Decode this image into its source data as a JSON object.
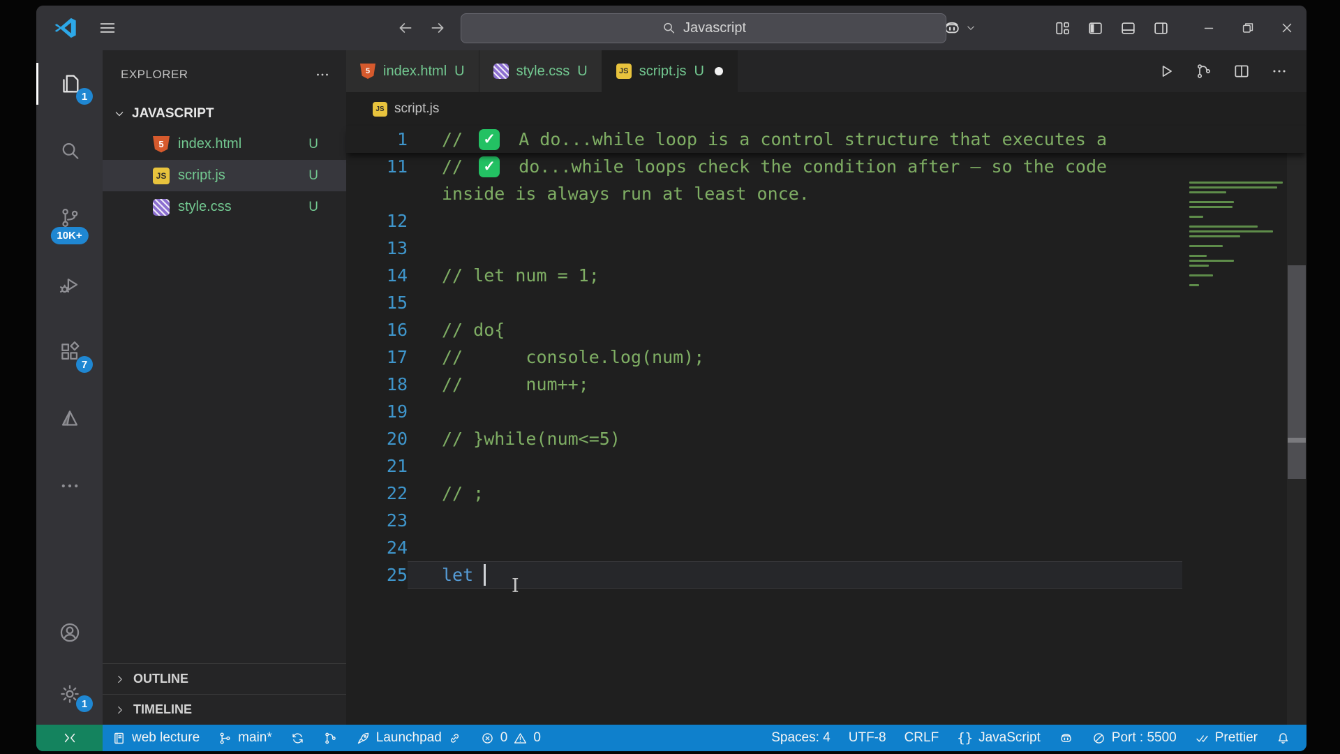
{
  "colors": {
    "status_bar": "#0f80cc",
    "remote": "#14835e",
    "badge": "#1f87d2",
    "comment_green": "#7fae64",
    "keyword_blue": "#569cd6",
    "untracked_green": "#73c991",
    "line_number_blue": "#3f96cc"
  },
  "titlebar": {
    "search_text": "Javascript"
  },
  "activity_bar": {
    "items": [
      {
        "id": "explorer",
        "icon": "files",
        "badge": "1",
        "active": true
      },
      {
        "id": "search",
        "icon": "search",
        "badge": ""
      },
      {
        "id": "source-control",
        "icon": "scm",
        "badge": "10K+",
        "pill": true
      },
      {
        "id": "run-and-debug",
        "icon": "debug",
        "badge": ""
      },
      {
        "id": "extensions",
        "icon": "ext",
        "badge": "7"
      },
      {
        "id": "prism-extension",
        "icon": "prism",
        "badge": ""
      },
      {
        "id": "additional-views",
        "icon": "more",
        "badge": ""
      }
    ],
    "bottom": [
      {
        "id": "accounts",
        "icon": "account",
        "badge": ""
      },
      {
        "id": "settings",
        "icon": "gear",
        "badge": "1"
      }
    ]
  },
  "sidebar": {
    "title": "EXPLORER",
    "section_label": "JAVASCRIPT",
    "files": [
      {
        "name": "index.html",
        "icon": "html",
        "glyph": "5",
        "badge": "U",
        "selected": false
      },
      {
        "name": "script.js",
        "icon": "js",
        "glyph": "JS",
        "badge": "U",
        "selected": true
      },
      {
        "name": "style.css",
        "icon": "css",
        "glyph": "",
        "badge": "U",
        "selected": false
      }
    ],
    "panels": [
      "OUTLINE",
      "TIMELINE"
    ]
  },
  "tabs": [
    {
      "name": "index.html",
      "icon": "html",
      "glyph": "5",
      "badge": "U",
      "active": false,
      "dirty": false
    },
    {
      "name": "style.css",
      "icon": "css",
      "glyph": "",
      "badge": "U",
      "active": false,
      "dirty": false
    },
    {
      "name": "script.js",
      "icon": "js",
      "glyph": "JS",
      "badge": "U",
      "active": true,
      "dirty": true
    }
  ],
  "editor_actions": [
    {
      "id": "run-file",
      "icon": "play"
    },
    {
      "id": "run-or-debug",
      "icon": "graph"
    },
    {
      "id": "split-editor",
      "icon": "split"
    },
    {
      "id": "more-actions",
      "icon": "dots"
    }
  ],
  "breadcrumb": {
    "file": "script.js",
    "icon": "js",
    "glyph": "JS"
  },
  "editor": {
    "lines": [
      {
        "num": "1",
        "check": true,
        "text": "A do...while loop is a control structure that executes a",
        "sticky": true
      },
      {
        "num": "11",
        "check": true,
        "text": "do...while loops check the condition after — so the code"
      },
      {
        "num": "",
        "text": "inside is always run at least once.",
        "wrap": true
      },
      {
        "num": "12",
        "text": ""
      },
      {
        "num": "13",
        "text": ""
      },
      {
        "num": "14",
        "text": "// let num = 1;"
      },
      {
        "num": "15",
        "text": ""
      },
      {
        "num": "16",
        "text": "// do{"
      },
      {
        "num": "17",
        "text": "//      console.log(num);"
      },
      {
        "num": "18",
        "text": "//      num++;"
      },
      {
        "num": "19",
        "text": ""
      },
      {
        "num": "20",
        "text": "// }while(num<=5)"
      },
      {
        "num": "21",
        "text": ""
      },
      {
        "num": "22",
        "text": "// ;"
      },
      {
        "num": "23",
        "text": ""
      },
      {
        "num": "24",
        "text": ""
      },
      {
        "num": "25",
        "text": "let ",
        "keyword": true,
        "cursor": true,
        "current": true
      }
    ],
    "minimap_bars": [
      96,
      90,
      38,
      0,
      46,
      44,
      0,
      14,
      0,
      70,
      86,
      52,
      0,
      34,
      0,
      18,
      46,
      20,
      0,
      24,
      0,
      10
    ]
  },
  "status_bar": {
    "left": [
      {
        "id": "profile",
        "icon": "book",
        "text": "web lecture"
      },
      {
        "id": "branch",
        "icon": "branch",
        "text": "main*"
      },
      {
        "id": "sync",
        "icon": "sync",
        "text": ""
      },
      {
        "id": "commit-graph",
        "icon": "graph",
        "text": ""
      },
      {
        "id": "launchpad",
        "icon": "rocket",
        "icon2": "link",
        "text": "Launchpad"
      },
      {
        "id": "problems",
        "icon": "err",
        "text": "0",
        "icon2": "warn",
        "text2": "0"
      }
    ],
    "right": [
      {
        "id": "indentation",
        "text": "Spaces: 4"
      },
      {
        "id": "encoding",
        "text": "UTF-8"
      },
      {
        "id": "eol",
        "text": "CRLF"
      },
      {
        "id": "language-mode",
        "braces": true,
        "text": "JavaScript"
      },
      {
        "id": "copilot-status",
        "icon": "copilot",
        "text": ""
      },
      {
        "id": "live-server-port",
        "icon": "slash",
        "text": "Port : 5500"
      },
      {
        "id": "prettier",
        "icon": "checks",
        "text": "Prettier"
      },
      {
        "id": "notifications",
        "icon": "bell",
        "text": ""
      }
    ]
  }
}
